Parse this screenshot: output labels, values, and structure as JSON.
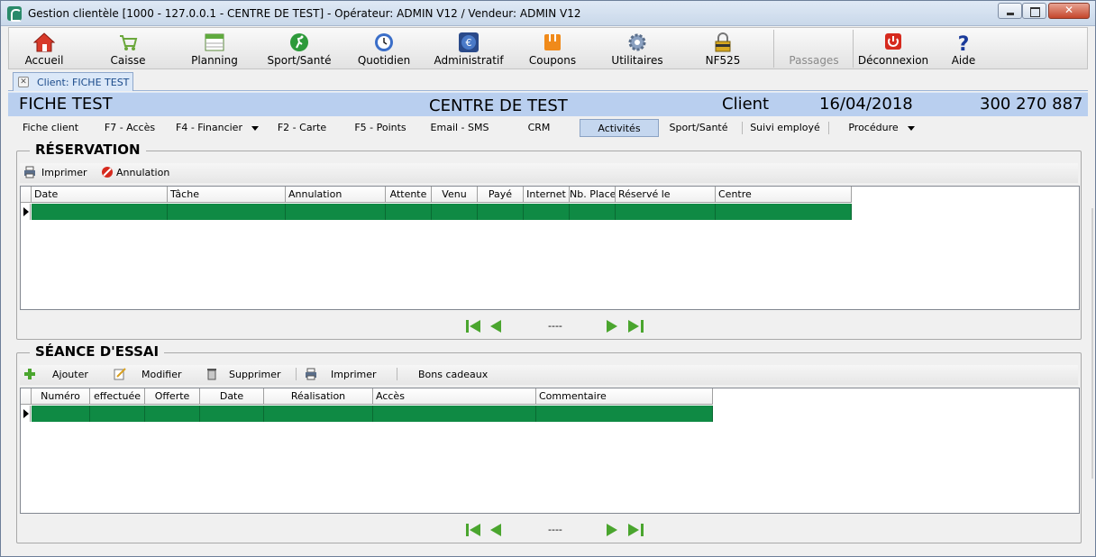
{
  "window": {
    "title": "Gestion clientèle [1000 - 127.0.0.1 - CENTRE DE TEST] - Opérateur: ADMIN V12 / Vendeur: ADMIN V12"
  },
  "toolbar": {
    "items": [
      {
        "label": "Accueil",
        "icon": "home-icon",
        "has_dropdown": true
      },
      {
        "label": "Caisse",
        "icon": "cart-icon",
        "has_dropdown": true
      },
      {
        "label": "Planning",
        "icon": "calendar-icon",
        "has_dropdown": true
      },
      {
        "label": "Sport/Santé",
        "icon": "runner-icon",
        "has_dropdown": true
      },
      {
        "label": "Quotidien",
        "icon": "clock-icon",
        "has_dropdown": true
      },
      {
        "label": "Administratif",
        "icon": "euro-icon",
        "has_dropdown": true
      },
      {
        "label": "Coupons",
        "icon": "coupon-icon",
        "has_dropdown": true
      },
      {
        "label": "Utilitaires",
        "icon": "gear-icon",
        "has_dropdown": true
      },
      {
        "label": "NF525",
        "icon": "lock-icon",
        "has_dropdown": true
      },
      {
        "label": "Passages",
        "icon": "",
        "has_dropdown": false,
        "disabled": true
      },
      {
        "label": "Déconnexion",
        "icon": "power-icon",
        "has_dropdown": false
      },
      {
        "label": "Aide",
        "icon": "help-icon",
        "has_dropdown": true
      }
    ]
  },
  "doc_tab": {
    "label": "Client: FICHE TEST"
  },
  "header": {
    "client_name": "FICHE TEST",
    "center": "CENTRE DE TEST",
    "type": "Client",
    "date": "16/04/2018",
    "phone": "300 270 887"
  },
  "subnav": {
    "items": [
      {
        "label": "Fiche client"
      },
      {
        "label": "F7 - Accès"
      },
      {
        "label": "F4 - Financier",
        "has_dropdown": true
      },
      {
        "label": "F2 - Carte"
      },
      {
        "label": "F5 - Points"
      },
      {
        "label": "Email - SMS"
      },
      {
        "label": "CRM"
      },
      {
        "label": "Activités",
        "active": true
      },
      {
        "label": "Sport/Santé"
      },
      {
        "label": "Suivi employé"
      },
      {
        "label": "Procédure",
        "has_dropdown": true
      }
    ]
  },
  "reservation": {
    "title": "RÉSERVATION",
    "actions": {
      "print": "Imprimer",
      "cancel": "Annulation"
    },
    "columns": [
      "Date",
      "Tâche",
      "Annulation",
      "Attente",
      "Venu",
      "Payé",
      "Internet",
      "Nb. Place",
      "Réservé le",
      "Centre"
    ],
    "pager_text": "----"
  },
  "trial": {
    "title": "SÉANCE D'ESSAI",
    "actions": {
      "add": "Ajouter",
      "edit": "Modifier",
      "delete": "Supprimer",
      "print": "Imprimer",
      "gift": "Bons cadeaux"
    },
    "columns": [
      "Numéro",
      "effectuée",
      "Offerte",
      "Date",
      "Réalisation",
      "Accès",
      "Commentaire"
    ],
    "pager_text": "----"
  },
  "colors": {
    "selected_row": "#0f8a44",
    "header_band": "#b9cfef",
    "active_tab": "#c5d7ef",
    "nav_arrows": "#4aa52e"
  }
}
